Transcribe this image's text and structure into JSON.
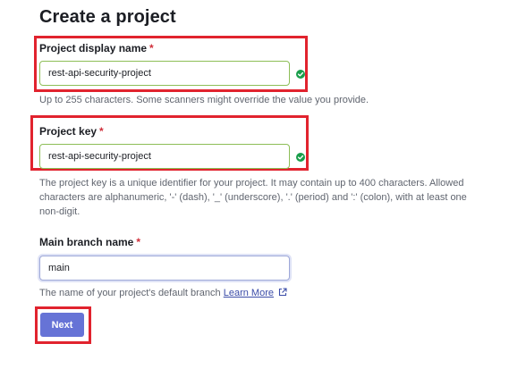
{
  "page": {
    "title": "Create a project"
  },
  "display_name": {
    "label": "Project display name",
    "required": "*",
    "value": "rest-api-security-project",
    "help": "Up to 255 characters. Some scanners might override the value you provide."
  },
  "project_key": {
    "label": "Project key",
    "required": "*",
    "value": "rest-api-security-project",
    "help_line1": "The project key is a unique identifier for your project. It may contain up to 400 characters. Allowed",
    "help_line2": "characters are alphanumeric, '-' (dash), '_' (underscore), '.' (period) and ':' (colon), with at least one",
    "help_line3": "non-digit."
  },
  "branch": {
    "label": "Main branch name",
    "required": "*",
    "value": "main",
    "help": "The name of your project's default branch",
    "link_label": "Learn More"
  },
  "actions": {
    "next_label": "Next"
  },
  "colors": {
    "primary": "#6673d6",
    "valid": "#1a9e4b",
    "highlight": "#e1232e",
    "required": "#d02f3a"
  },
  "icons": {
    "valid": "check-circle-icon",
    "external": "external-link-icon"
  }
}
